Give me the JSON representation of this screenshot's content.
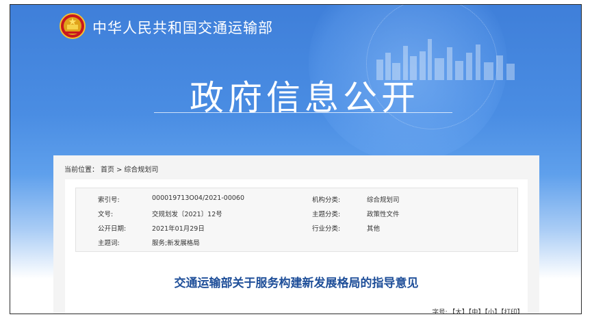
{
  "header": {
    "ministry_name": "中华人民共和国交通运输部",
    "section_title": "政府信息公开"
  },
  "breadcrumb": {
    "label": "当前位置：",
    "home": "首页",
    "separator": ">",
    "current": "综合规划司"
  },
  "metadata": {
    "index_label": "索引号:",
    "index_value": "000019713O04/2021-00060",
    "org_label": "机构分类:",
    "org_value": "综合规划司",
    "doc_no_label": "文号:",
    "doc_no_value": "交规划发〔2021〕12号",
    "topic_label": "主题分类:",
    "topic_value": "政策性文件",
    "date_label": "公开日期:",
    "date_value": "2021年01月29日",
    "industry_label": "行业分类:",
    "industry_value": "其他",
    "keywords_label": "主题词:",
    "keywords_value": "服务;新发展格局"
  },
  "document": {
    "title": "交通运输部关于服务构建新发展格局的指导意见"
  },
  "font_controls": {
    "label": "字号:",
    "large": "【大】",
    "medium": "【中】",
    "small": "【小】",
    "print": "【打印】"
  },
  "colors": {
    "banner_blue": "#4a8de3",
    "title_blue": "#1f4f99"
  }
}
